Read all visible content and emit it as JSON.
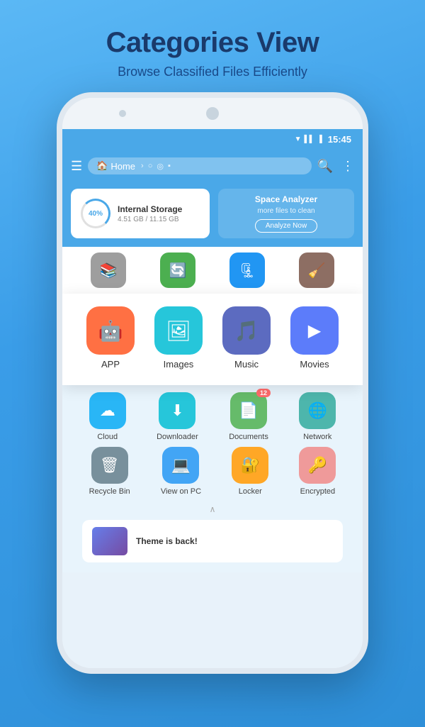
{
  "hero": {
    "title": "Categories View",
    "subtitle": "Browse Classified Files Efficiently"
  },
  "status_bar": {
    "time": "15:45"
  },
  "toolbar": {
    "home_label": "Home",
    "search_label": "Search",
    "more_label": "More"
  },
  "storage": {
    "percent": "40%",
    "title": "Internal Storage",
    "size": "4.51 GB / 11.15 GB"
  },
  "analyzer": {
    "title": "Space Analyzer",
    "subtitle": "more files to clean",
    "button": "Analyze Now"
  },
  "categories": [
    {
      "id": "app",
      "label": "APP",
      "icon": "🤖",
      "color": "bg-app"
    },
    {
      "id": "images",
      "label": "Images",
      "icon": "🖼",
      "color": "bg-img"
    },
    {
      "id": "music",
      "label": "Music",
      "icon": "🎵",
      "color": "bg-music"
    },
    {
      "id": "movies",
      "label": "Movies",
      "icon": "▶",
      "color": "bg-movie"
    }
  ],
  "secondary_row1": [
    {
      "id": "cloud",
      "label": "Cloud",
      "icon": "☁",
      "color": "bg-cloud",
      "badge": ""
    },
    {
      "id": "downloader",
      "label": "Downloader",
      "icon": "⬇",
      "color": "bg-download",
      "badge": ""
    },
    {
      "id": "documents",
      "label": "Documents",
      "icon": "📄",
      "color": "bg-doc",
      "badge": "12"
    },
    {
      "id": "network",
      "label": "Network",
      "icon": "🔒",
      "color": "bg-network",
      "badge": ""
    }
  ],
  "secondary_row2": [
    {
      "id": "recycle",
      "label": "Recycle Bin",
      "icon": "🗑",
      "color": "bg-recycle",
      "badge": ""
    },
    {
      "id": "viewpc",
      "label": "View on PC",
      "icon": "💻",
      "color": "bg-viewpc",
      "badge": ""
    },
    {
      "id": "locker",
      "label": "Locker",
      "icon": "🔐",
      "color": "bg-locker",
      "badge": ""
    },
    {
      "id": "encrypted",
      "label": "Encrypted",
      "icon": "🔑",
      "color": "bg-encrypted",
      "badge": ""
    }
  ],
  "partial_icons": [
    {
      "icon": "📚",
      "color": "#9e9e9e"
    },
    {
      "icon": "🔄",
      "color": "#4caf50"
    },
    {
      "icon": "🗜",
      "color": "#2196f3"
    },
    {
      "icon": "🧹",
      "color": "#8d6e63"
    }
  ],
  "bottom_banner": {
    "text": "Theme is back!"
  }
}
